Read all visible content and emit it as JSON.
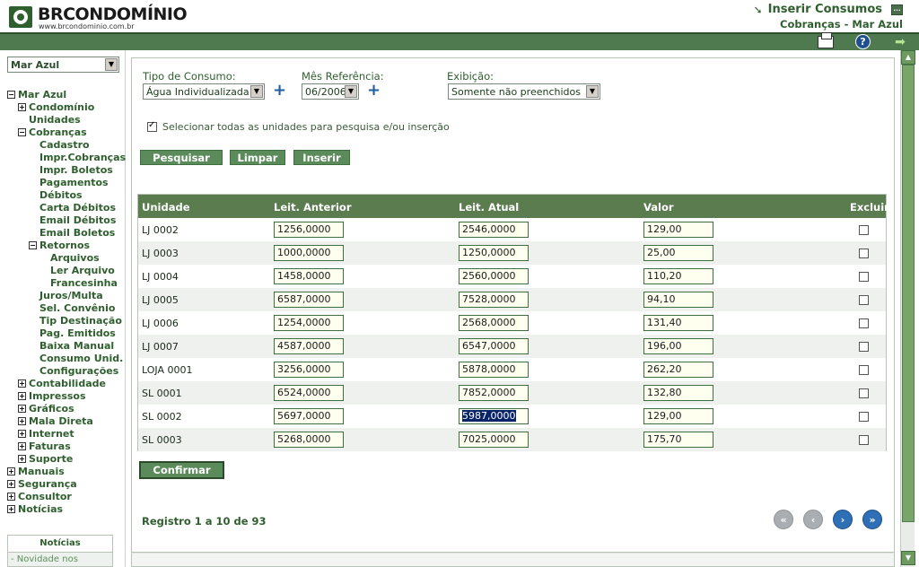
{
  "header": {
    "logo_text": "BRCONDOMÍNIO",
    "logo_url": "www.brcondominio.com.br",
    "title": "Inserir Consumos",
    "subtitle": "Cobranças - Mar Azul"
  },
  "sidebar": {
    "selected_condo": "Mar Azul",
    "tree": [
      {
        "label": "Mar Azul",
        "indent": 0,
        "toggle": "−"
      },
      {
        "label": "Condomínio",
        "indent": 1,
        "toggle": "+"
      },
      {
        "label": "Unidades",
        "indent": 1,
        "toggle": ""
      },
      {
        "label": "Cobranças",
        "indent": 1,
        "toggle": "−"
      },
      {
        "label": "Cadastro",
        "indent": 2,
        "toggle": ""
      },
      {
        "label": "Impr.Cobranças",
        "indent": 2,
        "toggle": ""
      },
      {
        "label": "Impr. Boletos",
        "indent": 2,
        "toggle": ""
      },
      {
        "label": "Pagamentos",
        "indent": 2,
        "toggle": ""
      },
      {
        "label": "Débitos",
        "indent": 2,
        "toggle": ""
      },
      {
        "label": "Carta Débitos",
        "indent": 2,
        "toggle": ""
      },
      {
        "label": "Email Débitos",
        "indent": 2,
        "toggle": ""
      },
      {
        "label": "Email Boletos",
        "indent": 2,
        "toggle": ""
      },
      {
        "label": "Retornos",
        "indent": 2,
        "toggle": "−"
      },
      {
        "label": "Arquivos",
        "indent": 3,
        "toggle": ""
      },
      {
        "label": "Ler Arquivo",
        "indent": 3,
        "toggle": ""
      },
      {
        "label": "Francesinha",
        "indent": 3,
        "toggle": ""
      },
      {
        "label": "Juros/Multa",
        "indent": 2,
        "toggle": ""
      },
      {
        "label": "Sel. Convênio",
        "indent": 2,
        "toggle": ""
      },
      {
        "label": "Tip Destinação",
        "indent": 2,
        "toggle": ""
      },
      {
        "label": "Pag. Emitidos",
        "indent": 2,
        "toggle": ""
      },
      {
        "label": "Baixa Manual",
        "indent": 2,
        "toggle": ""
      },
      {
        "label": "Consumo Unid.",
        "indent": 2,
        "toggle": ""
      },
      {
        "label": "Configurações",
        "indent": 2,
        "toggle": ""
      },
      {
        "label": "Contabilidade",
        "indent": 1,
        "toggle": "+"
      },
      {
        "label": "Impressos",
        "indent": 1,
        "toggle": "+"
      },
      {
        "label": "Gráficos",
        "indent": 1,
        "toggle": "+"
      },
      {
        "label": "Mala Direta",
        "indent": 1,
        "toggle": "+"
      },
      {
        "label": "Internet",
        "indent": 1,
        "toggle": "+"
      },
      {
        "label": "Faturas",
        "indent": 1,
        "toggle": "+"
      },
      {
        "label": "Suporte",
        "indent": 1,
        "toggle": "+"
      },
      {
        "label": "Manuais",
        "indent": 0,
        "toggle": "+"
      },
      {
        "label": "Segurança",
        "indent": 0,
        "toggle": "+"
      },
      {
        "label": "Consultor",
        "indent": 0,
        "toggle": "+"
      },
      {
        "label": "Notícias",
        "indent": 0,
        "toggle": "+"
      }
    ],
    "news_title": "Notícias",
    "news_item": "- Novidade nos"
  },
  "filters": {
    "tipo_label": "Tipo de Consumo:",
    "tipo_value": "Água Individualizada",
    "mes_label": "Mês Referência:",
    "mes_value": "06/2006",
    "exibicao_label": "Exibição:",
    "exibicao_value": "Somente não preenchidos",
    "select_all_label": "Selecionar todas as unidades para pesquisa e/ou inserção",
    "select_all_checked": true
  },
  "buttons": {
    "pesquisar": "Pesquisar",
    "limpar": "Limpar",
    "inserir": "Inserir",
    "confirmar": "Confirmar"
  },
  "table": {
    "headers": [
      "Unidade",
      "Leit. Anterior",
      "Leit. Atual",
      "Valor",
      "Excluir"
    ],
    "rows": [
      {
        "unidade": "LJ 0002",
        "anterior": "1256,0000",
        "atual": "2546,0000",
        "valor": "129,00"
      },
      {
        "unidade": "LJ 0003",
        "anterior": "1000,0000",
        "atual": "1250,0000",
        "valor": "25,00"
      },
      {
        "unidade": "LJ 0004",
        "anterior": "1458,0000",
        "atual": "2560,0000",
        "valor": "110,20"
      },
      {
        "unidade": "LJ 0005",
        "anterior": "6587,0000",
        "atual": "7528,0000",
        "valor": "94,10"
      },
      {
        "unidade": "LJ 0006",
        "anterior": "1254,0000",
        "atual": "2568,0000",
        "valor": "131,40"
      },
      {
        "unidade": "LJ 0007",
        "anterior": "4587,0000",
        "atual": "6547,0000",
        "valor": "196,00"
      },
      {
        "unidade": "LOJA 0001",
        "anterior": "3256,0000",
        "atual": "5878,0000",
        "valor": "262,20"
      },
      {
        "unidade": "SL 0001",
        "anterior": "6524,0000",
        "atual": "7852,0000",
        "valor": "132,80"
      },
      {
        "unidade": "SL 0002",
        "anterior": "5697,0000",
        "atual": "5987,0000",
        "valor": "129,00"
      },
      {
        "unidade": "SL 0003",
        "anterior": "5268,0000",
        "atual": "7025,0000",
        "valor": "175,70"
      }
    ]
  },
  "pagination": {
    "registro_text": "Registro 1 a 10 de 93",
    "first": "«",
    "prev": "‹",
    "next": "›",
    "last": "»"
  },
  "icons": {
    "toggle_minus": "−",
    "toggle_plus": "+",
    "dropdown": "▼",
    "scroll_up": "▲",
    "scroll_down": "▼",
    "add": "+",
    "help": "?",
    "exit": "➡",
    "header_arrow": "➘",
    "header_box": "..."
  },
  "colors": {
    "brand_green": "#4f7a4f",
    "header_green": "#5b7c4f",
    "link_blue": "#2f6fb6"
  }
}
